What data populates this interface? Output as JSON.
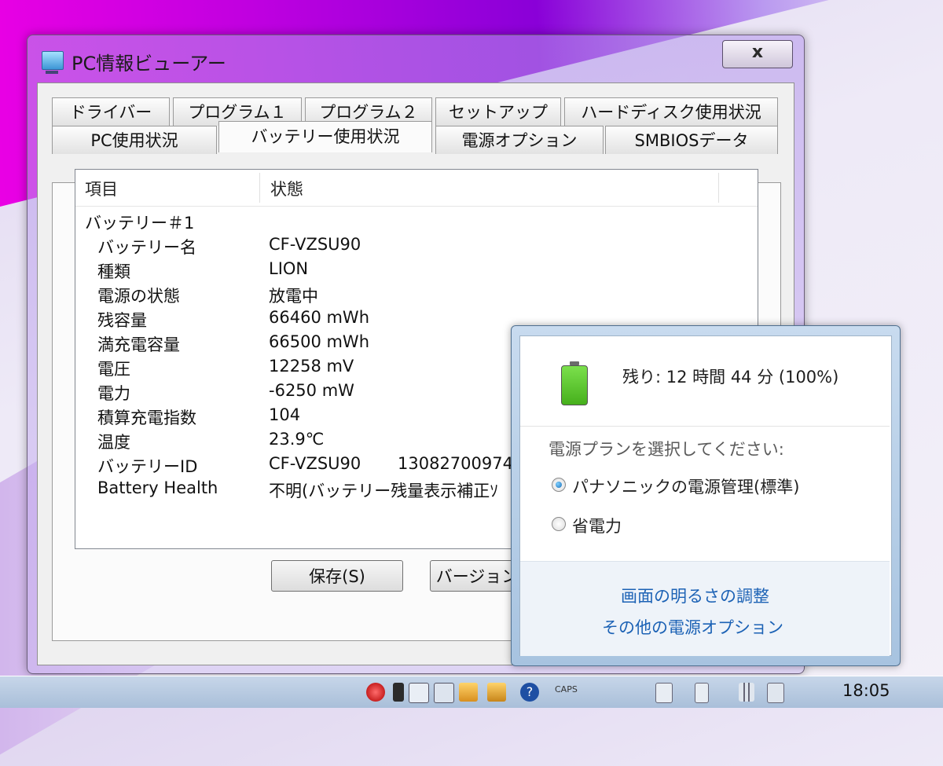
{
  "window": {
    "title": "PC情報ビューアー",
    "close_label": "x"
  },
  "tabs": {
    "row1": [
      "ドライバー",
      "プログラム１",
      "プログラム２",
      "セットアップ",
      "ハードディスク使用状況"
    ],
    "row2": [
      "PC使用状況",
      "バッテリー使用状況",
      "電源オプション",
      "SMBIOSデータ"
    ],
    "active": "バッテリー使用状況"
  },
  "list": {
    "columns": [
      "項目",
      "状態"
    ],
    "group": "バッテリー＃1",
    "rows": [
      {
        "key": "バッテリー名",
        "value": "CF-VZSU90",
        "extra": ""
      },
      {
        "key": "種類",
        "value": "LION",
        "extra": ""
      },
      {
        "key": "電源の状態",
        "value": "放電中",
        "extra": ""
      },
      {
        "key": "残容量",
        "value": "66460 mWh",
        "extra": ""
      },
      {
        "key": "満充電容量",
        "value": "66500 mWh",
        "extra": ""
      },
      {
        "key": "電圧",
        "value": "12258 mV",
        "extra": ""
      },
      {
        "key": "電力",
        "value": "-6250 mW",
        "extra": ""
      },
      {
        "key": "積算充電指数",
        "value": "104",
        "extra": ""
      },
      {
        "key": "温度",
        "value": "23.9℃",
        "extra": ""
      },
      {
        "key": "バッテリーID",
        "value": "CF-VZSU90",
        "extra": "13082700974"
      },
      {
        "key": "Battery Health",
        "value": "不明(バッテリー残量表示補正ｿ",
        "extra": ""
      }
    ]
  },
  "buttons": {
    "save": "保存(S)",
    "version": "バージョン"
  },
  "power_flyout": {
    "remaining": "残り: 12 時間 44 分 (100%)",
    "battery_level": 1.0,
    "plan_heading": "電源プランを選択してください:",
    "plans": [
      {
        "label": "パナソニックの電源管理(標準)",
        "selected": true
      },
      {
        "label": "省電力",
        "selected": false
      }
    ],
    "links": [
      "画面の明るさの調整",
      "その他の電源オプション"
    ]
  },
  "taskbar": {
    "caps": "CAPS",
    "clock": "18:05"
  },
  "icons": [
    "app-icon",
    "battery-icon",
    "flag-icon",
    "question-icon",
    "volume-icon",
    "network-icon"
  ]
}
